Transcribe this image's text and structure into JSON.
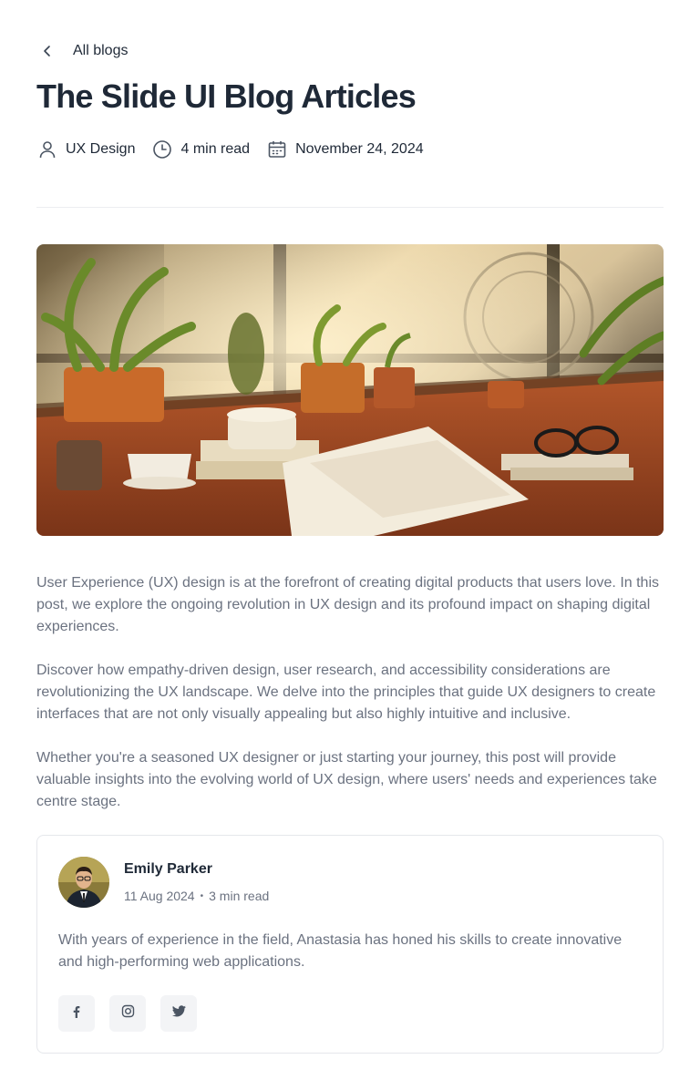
{
  "nav": {
    "back_label": "All blogs",
    "back_icon": "chevron-left-icon"
  },
  "article": {
    "title": "The Slide UI Blog Articles",
    "category": "UX Design",
    "read_time": "4 min read",
    "date": "November 24, 2024",
    "paragraphs": [
      "User Experience (UX) design is at the forefront of creating digital products that users love. In this post, we explore the ongoing revolution in UX design and its profound impact on shaping digital experiences.",
      "Discover how empathy-driven design, user research, and accessibility considerations are revolutionizing the UX landscape. We delve into the principles that guide UX designers to create interfaces that are not only visually appealing but also highly intuitive and inclusive.",
      "Whether you're a seasoned UX designer or just starting your journey, this post will provide valuable insights into the evolving world of UX design, where users' needs and experiences take centre stage."
    ]
  },
  "author": {
    "name": "Emily Parker",
    "date": "11 Aug 2024",
    "read_time": "3 min read",
    "separator": "•",
    "bio": "With years of experience in the field, Anastasia has honed his skills to create innovative and high-performing web applications.",
    "socials": [
      "facebook-icon",
      "instagram-icon",
      "twitter-icon"
    ]
  },
  "colors": {
    "text_primary": "#1f2937",
    "text_secondary": "#6b7280",
    "border": "#e5e7eb",
    "social_bg": "#f3f4f6"
  }
}
